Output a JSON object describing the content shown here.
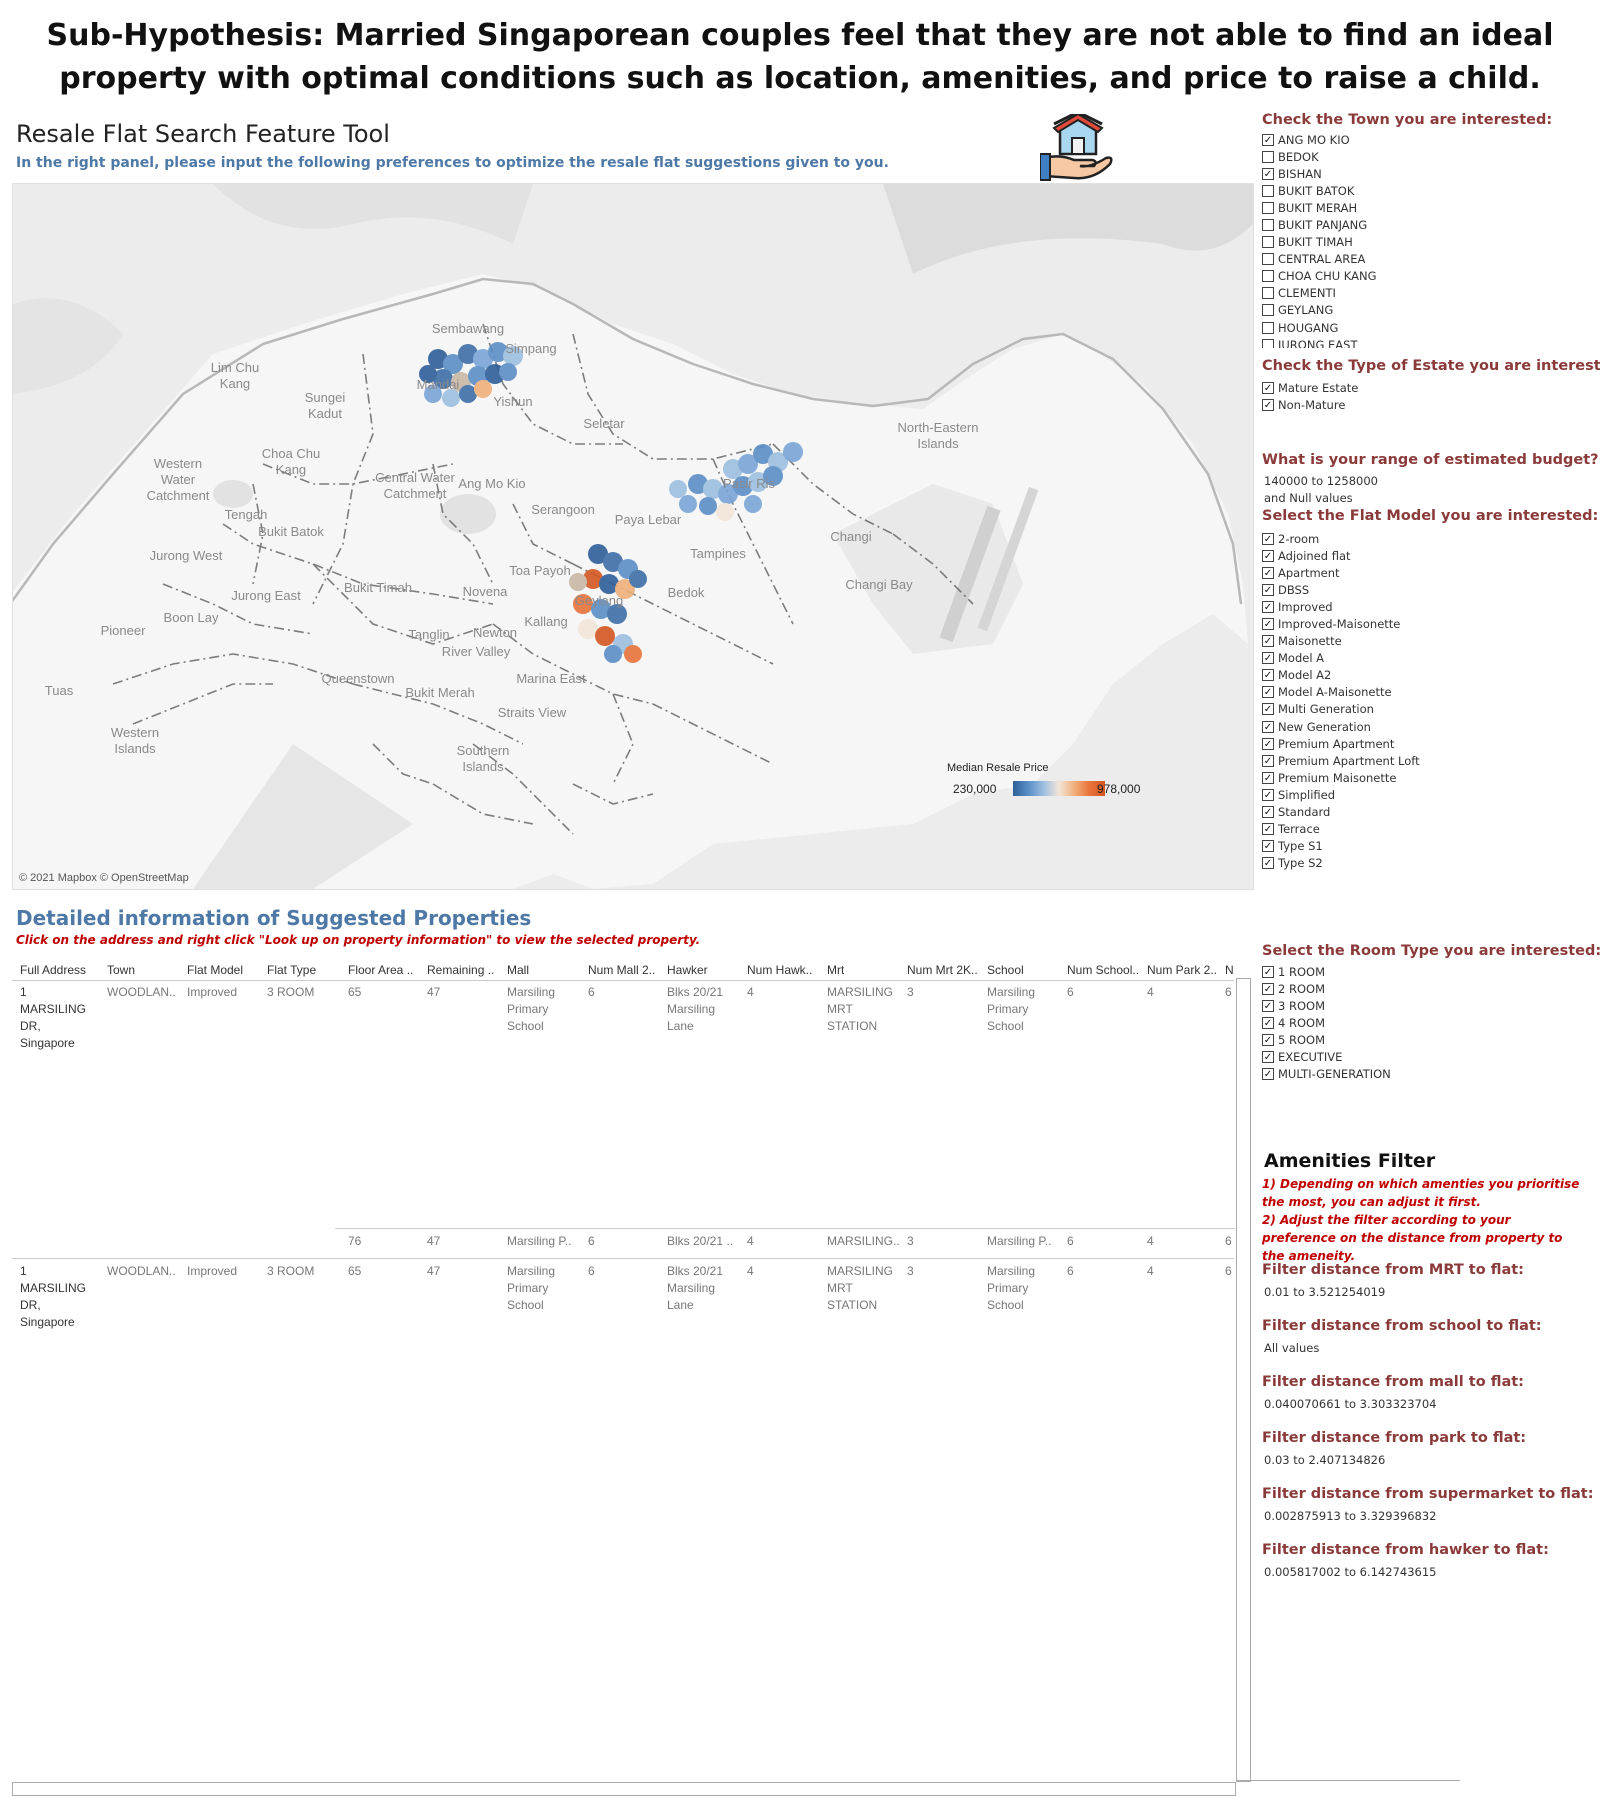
{
  "hypothesis": "Sub-Hypothesis: Married Singaporean couples feel that they are not able to find an ideal property with optimal conditions such as location, amenities, and price to raise a child.",
  "tool": {
    "title": "Resale Flat Search Feature Tool",
    "subtitle": "In the right panel, please input the following preferences to optimize the resale flat suggestions given to you.",
    "icon": "house-in-hand-icon"
  },
  "map": {
    "places": [
      "Sembawang",
      "Simpang",
      "Lim Chu\nKang",
      "Mandai",
      "Yishun",
      "Sungei\nKadut",
      "Seletar",
      "North-Eastern\nIslands",
      "Western\nWater\nCatchment",
      "Choa Chu\nKang",
      "Central Water\nCatchment",
      "Pasir Ris",
      "Tengah",
      "Bukit Batok",
      "Ang Mo Kio",
      "Serangoon",
      "Paya Lebar",
      "Changi",
      "Jurong West",
      "Tampines",
      "Toa Payoh",
      "Changi Bay",
      "Bukit Timah",
      "Novena",
      "Geylang",
      "Bedok",
      "Jurong East",
      "Boon Lay",
      "Pioneer",
      "Tanglin",
      "Newton",
      "Kallang",
      "River Valley",
      "Queenstown",
      "Marina East",
      "Tuas",
      "Bukit Merah",
      "Straits View",
      "Western\nIslands",
      "Southern\nIslands"
    ],
    "legend_title": "Median Resale Price",
    "legend_min": "230,000",
    "legend_max": "978,000",
    "copyright": "© 2021 Mapbox © OpenStreetMap",
    "colors": {
      "low": "#2e5f9a",
      "mid": "#f3e5d8",
      "high": "#d35721"
    }
  },
  "detail": {
    "title": "Detailed information of Suggested Properties",
    "note": "Click on the address and right click \"Look up on property information\" to view the selected property.",
    "columns": [
      "Full Address",
      "Town",
      "Flat Model",
      "Flat Type",
      "Floor Area ..",
      "Remaining ..",
      "Mall",
      "Num Mall 2..",
      "Hawker",
      "Num Hawk..",
      "Mrt",
      "Num Mrt 2K..",
      "School",
      "Num School..",
      "Num Park 2..",
      "N"
    ],
    "row1": {
      "address": "1\nMARSILING\nDR,\nSingapore",
      "town": "WOODLAN..",
      "model": "Improved",
      "type": "3 ROOM",
      "area": "65",
      "lease": "47",
      "mall": "Marsiling\nPrimary\nSchool",
      "nmall": "6",
      "hawker": "Blks 20/21\nMarsiling\nLane",
      "nhawk": "4",
      "mrt": "MARSILING\nMRT\nSTATION",
      "nmrt": "3",
      "school": "Marsiling\nPrimary\nSchool",
      "nschool": "6",
      "npark": "4",
      "n": "6"
    },
    "row1b": {
      "area": "76",
      "lease": "47",
      "mall": "Marsiling P..",
      "nmall": "6",
      "hawker": "Blks 20/21 ..",
      "nhawk": "4",
      "mrt": "MARSILING..",
      "nmrt": "3",
      "school": "Marsiling P..",
      "nschool": "6",
      "npark": "4",
      "n": "6"
    },
    "row2": {
      "address": "1\nMARSILING\nDR,\nSingapore",
      "town": "WOODLAN..",
      "model": "Improved",
      "type": "3 ROOM",
      "area": "65",
      "lease": "47",
      "mall": "Marsiling\nPrimary\nSchool",
      "nmall": "6",
      "hawker": "Blks 20/21\nMarsiling\nLane",
      "nhawk": "4",
      "mrt": "MARSILING\nMRT\nSTATION",
      "nmrt": "3",
      "school": "Marsiling\nPrimary\nSchool",
      "nschool": "6",
      "npark": "4",
      "n": "6"
    }
  },
  "filters": {
    "town": {
      "heading": "Check the Town you are interested:",
      "items": [
        {
          "label": "ANG MO KIO",
          "checked": true
        },
        {
          "label": "BEDOK",
          "checked": false
        },
        {
          "label": "BISHAN",
          "checked": true
        },
        {
          "label": "BUKIT BATOK",
          "checked": false
        },
        {
          "label": "BUKIT MERAH",
          "checked": false
        },
        {
          "label": "BUKIT PANJANG",
          "checked": false
        },
        {
          "label": "BUKIT TIMAH",
          "checked": false
        },
        {
          "label": "CENTRAL AREA",
          "checked": false
        },
        {
          "label": "CHOA CHU KANG",
          "checked": false
        },
        {
          "label": "CLEMENTI",
          "checked": false
        },
        {
          "label": "GEYLANG",
          "checked": false
        },
        {
          "label": "HOUGANG",
          "checked": false
        },
        {
          "label": "JURONG EAST",
          "checked": false
        }
      ]
    },
    "estate": {
      "heading": "Check the Type of Estate you are interested:",
      "items": [
        {
          "label": "Mature Estate",
          "checked": true
        },
        {
          "label": "Non-Mature",
          "checked": true
        }
      ]
    },
    "budget": {
      "heading": "What is your range of estimated budget?",
      "value": "140000 to 1258000",
      "nulls": "and Null values"
    },
    "flat_model": {
      "heading": "Select the Flat Model you are interested:",
      "items": [
        "2-room",
        "Adjoined flat",
        "Apartment",
        "DBSS",
        "Improved",
        "Improved-Maisonette",
        "Maisonette",
        "Model A",
        "Model A2",
        "Model A-Maisonette",
        "Multi Generation",
        "New Generation",
        "Premium Apartment",
        "Premium Apartment Loft",
        "Premium Maisonette",
        "Simplified",
        "Standard",
        "Terrace",
        "Type S1",
        "Type S2"
      ]
    },
    "room": {
      "heading": "Select the Room Type you are interested:",
      "items": [
        "1 ROOM",
        "2 ROOM",
        "3 ROOM",
        "4 ROOM",
        "5 ROOM",
        "EXECUTIVE",
        "MULTI-GENERATION"
      ]
    },
    "amenities": {
      "title": "Amenities Filter",
      "note1": "1) Depending on which amenties you prioritise the most, you can adjust it first.",
      "note2": "2) Adjust the filter according to your preference on the distance from property to the ameneity.",
      "ranges": [
        {
          "label": "Filter distance from MRT to flat:",
          "value": "0.01 to 3.521254019"
        },
        {
          "label": "Filter distance from school to flat:",
          "value": "All values"
        },
        {
          "label": "Filter distance from mall to flat:",
          "value": "0.040070661 to 3.303323704"
        },
        {
          "label": "Filter distance from park to flat:",
          "value": "0.03 to 2.407134826"
        },
        {
          "label": "Filter distance from supermarket to flat:",
          "value": "0.002875913 to 3.329396832"
        },
        {
          "label": "Filter distance from hawker to flat:",
          "value": "0.005817002 to 6.142743615"
        }
      ]
    }
  }
}
